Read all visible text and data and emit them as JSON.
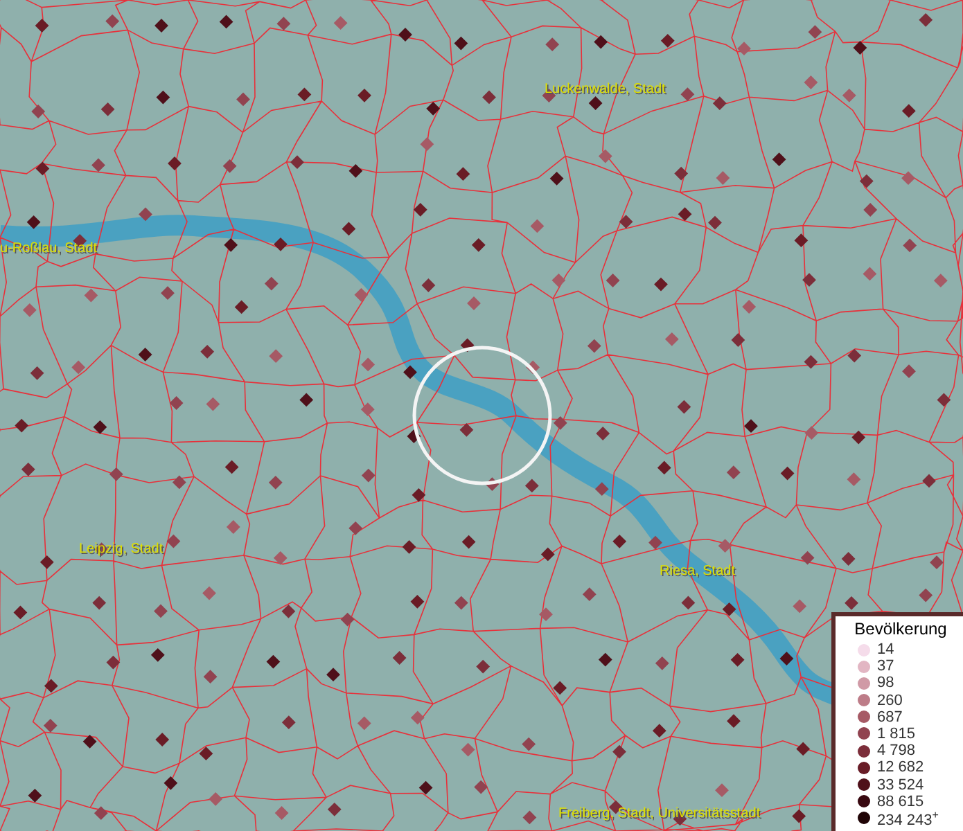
{
  "map": {
    "place_labels": [
      {
        "text": "Luckenwalde, Stadt"
      },
      {
        "text": "u-Roßlau, Stadt"
      },
      {
        "text": "Leipzig, Stadt"
      },
      {
        "text": "Riesa, Stadt"
      },
      {
        "text": "Freiberg, Stadt, Universitätsstadt"
      }
    ]
  },
  "legend": {
    "title": "Bevölkerung",
    "items": [
      {
        "label": "14",
        "color": "#f5dcea"
      },
      {
        "label": "37",
        "color": "#e2b6c3"
      },
      {
        "label": "98",
        "color": "#d09aa6"
      },
      {
        "label": "260",
        "color": "#bd7c88"
      },
      {
        "label": "687",
        "color": "#a65a65"
      },
      {
        "label": "1 815",
        "color": "#914350"
      },
      {
        "label": "4 798",
        "color": "#7c2e3a"
      },
      {
        "label": "12 682",
        "color": "#681c27"
      },
      {
        "label": "33 524",
        "color": "#4f101a"
      },
      {
        "label": "88 615",
        "color": "#380810"
      },
      {
        "label": "234 243$^{+}$",
        "color": "#200406"
      }
    ]
  }
}
